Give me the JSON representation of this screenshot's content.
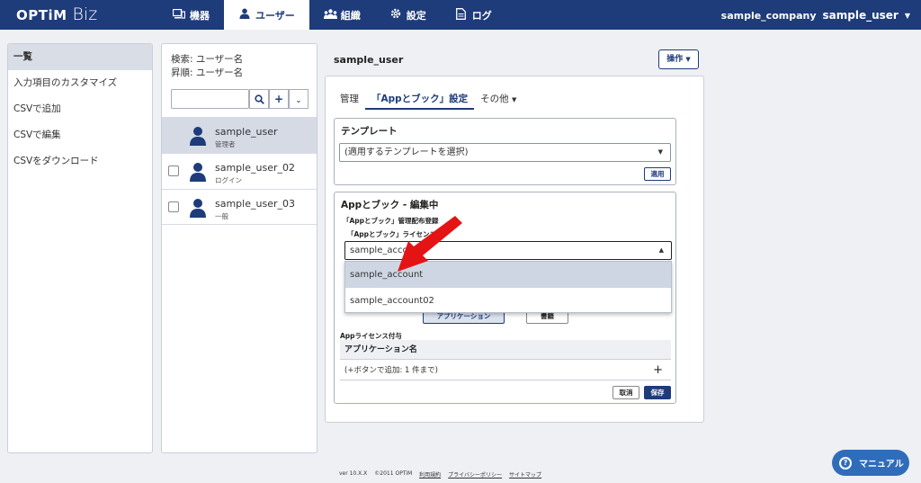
{
  "app": {
    "logo_main": "OPTiM",
    "logo_sub": "Biz",
    "company": "sample_company",
    "user": "sample_user"
  },
  "nav": {
    "tabs": [
      {
        "label": "機器",
        "icon": "device-icon"
      },
      {
        "label": "ユーザー",
        "icon": "user-icon"
      },
      {
        "label": "組織",
        "icon": "organization-icon"
      },
      {
        "label": "設定",
        "icon": "gear-icon"
      },
      {
        "label": "ログ",
        "icon": "log-icon"
      }
    ]
  },
  "sidebar": {
    "items": [
      {
        "label": "一覧"
      },
      {
        "label": "入力項目のカスタマイズ"
      },
      {
        "label": "CSVで追加"
      },
      {
        "label": "CSVで編集"
      },
      {
        "label": "CSVをダウンロード"
      }
    ]
  },
  "user_list": {
    "search_label": "検索: ユーザー名",
    "sort_label": "昇順: ユーザー名",
    "users": [
      {
        "name": "sample_user",
        "role": "管理者"
      },
      {
        "name": "sample_user_02",
        "role": "ログイン"
      },
      {
        "name": "sample_user_03",
        "role": "一般"
      }
    ]
  },
  "main": {
    "user_name": "sample_user",
    "ops_label": "操作",
    "tabs": [
      {
        "label": "管理"
      },
      {
        "label": "「Appとブック」設定"
      },
      {
        "label": "その他"
      }
    ],
    "template": {
      "title": "テンプレート",
      "select_value": "(適用するテンプレートを選択)",
      "apply_label": "適用"
    },
    "app_book": {
      "title": "Appとブック - 編集中",
      "dist_label": "「Appとブック」管理配布登録",
      "license_label": "「Appとブック」ライセンス",
      "select_value": "sample_account",
      "options": [
        "sample_account",
        "sample_account02"
      ],
      "app_btn": "アプリケーション",
      "book_btn": "書籍",
      "license_assign": "Appライセンス付与",
      "table_header": "アプリケーション名",
      "table_row": "(+ボタンで追加: 1 件まで)",
      "cancel_label": "取消",
      "save_label": "保存"
    }
  },
  "footer": {
    "version": "ver 10.X.X",
    "copyright": "©2011 OPTiM",
    "links": [
      "利用規約",
      "プライバシーポリシー",
      "サイトマップ"
    ]
  },
  "manual_label": "マニュアル",
  "colors": {
    "brand": "#1e3b7a",
    "annotation_arrow": "#e41414",
    "manual_button": "#2f6dbb"
  }
}
